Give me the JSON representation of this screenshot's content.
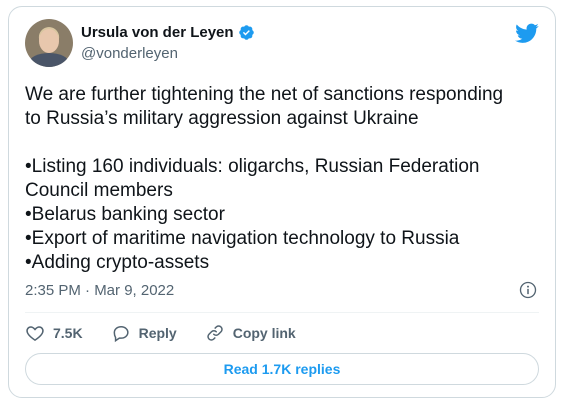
{
  "author": {
    "name": "Ursula von der Leyen",
    "handle": "@vonderleyen",
    "verified": true
  },
  "tweet": {
    "lines": [
      "We are further tightening the net of sanctions responding",
      "to Russia’s military aggression against Ukraine",
      "",
      "•Listing 160 individuals: oligarchs, Russian Federation",
      "Council members",
      "•Belarus banking sector",
      "•Export of maritime navigation technology to Russia",
      "•Adding crypto-assets"
    ],
    "timestamp": "2:35 PM · Mar 9, 2022"
  },
  "actions": {
    "like_count": "7.5K",
    "reply_label": "Reply",
    "copy_link_label": "Copy link"
  },
  "replies_button_label": "Read 1.7K replies",
  "icons": {
    "brand": "twitter-bird-icon",
    "verified": "verified-badge-icon",
    "info": "info-icon",
    "like": "heart-icon",
    "reply": "speech-bubble-icon",
    "copy_link": "link-icon"
  },
  "colors": {
    "brand": "#1d9bf0",
    "text": "#0f1419",
    "secondary": "#536471",
    "border": "#cfd9de"
  }
}
